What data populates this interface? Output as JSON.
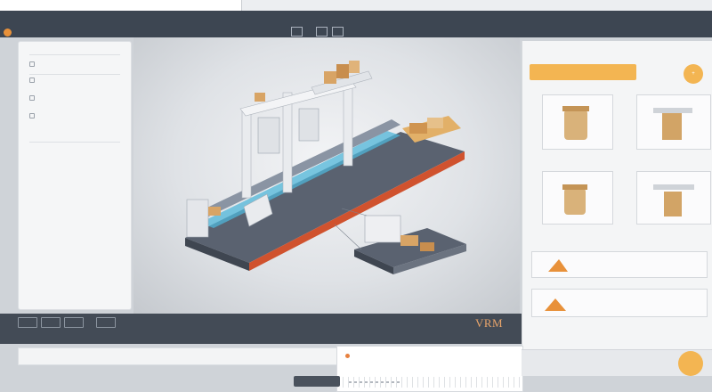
{
  "window": {
    "title": ""
  },
  "menubar": {
    "row1": [
      ""
    ],
    "row2": [
      ""
    ],
    "toolbar_buttons": [
      "",
      "",
      ""
    ]
  },
  "left_panel": {
    "items": [
      {
        "icon": "layers-icon",
        "label": ""
      },
      {
        "icon": "component-icon",
        "label": ""
      },
      {
        "icon": "grid-icon",
        "label": ""
      },
      {
        "icon": "folder-icon",
        "label": ""
      }
    ]
  },
  "right_panel": {
    "header": "",
    "thumbnails": [
      {
        "label": ""
      },
      {
        "label": ""
      },
      {
        "label": ""
      },
      {
        "label": ""
      }
    ],
    "section_label": ""
  },
  "bottom_bar": {
    "left_text": "",
    "center_text": "",
    "brand": "VRM",
    "brand_sub": ""
  },
  "status_bar": {
    "items": [
      "",
      "",
      "",
      "",
      ""
    ]
  },
  "detail_card": {
    "title": ""
  },
  "footer": {
    "pill_label": ""
  },
  "colors": {
    "accent": "#f3b552",
    "accent_dark": "#e7813f",
    "menubar": "#3d4652",
    "conveyor_highlight": "#4fb6d8",
    "edge_orange": "#d0522e"
  }
}
